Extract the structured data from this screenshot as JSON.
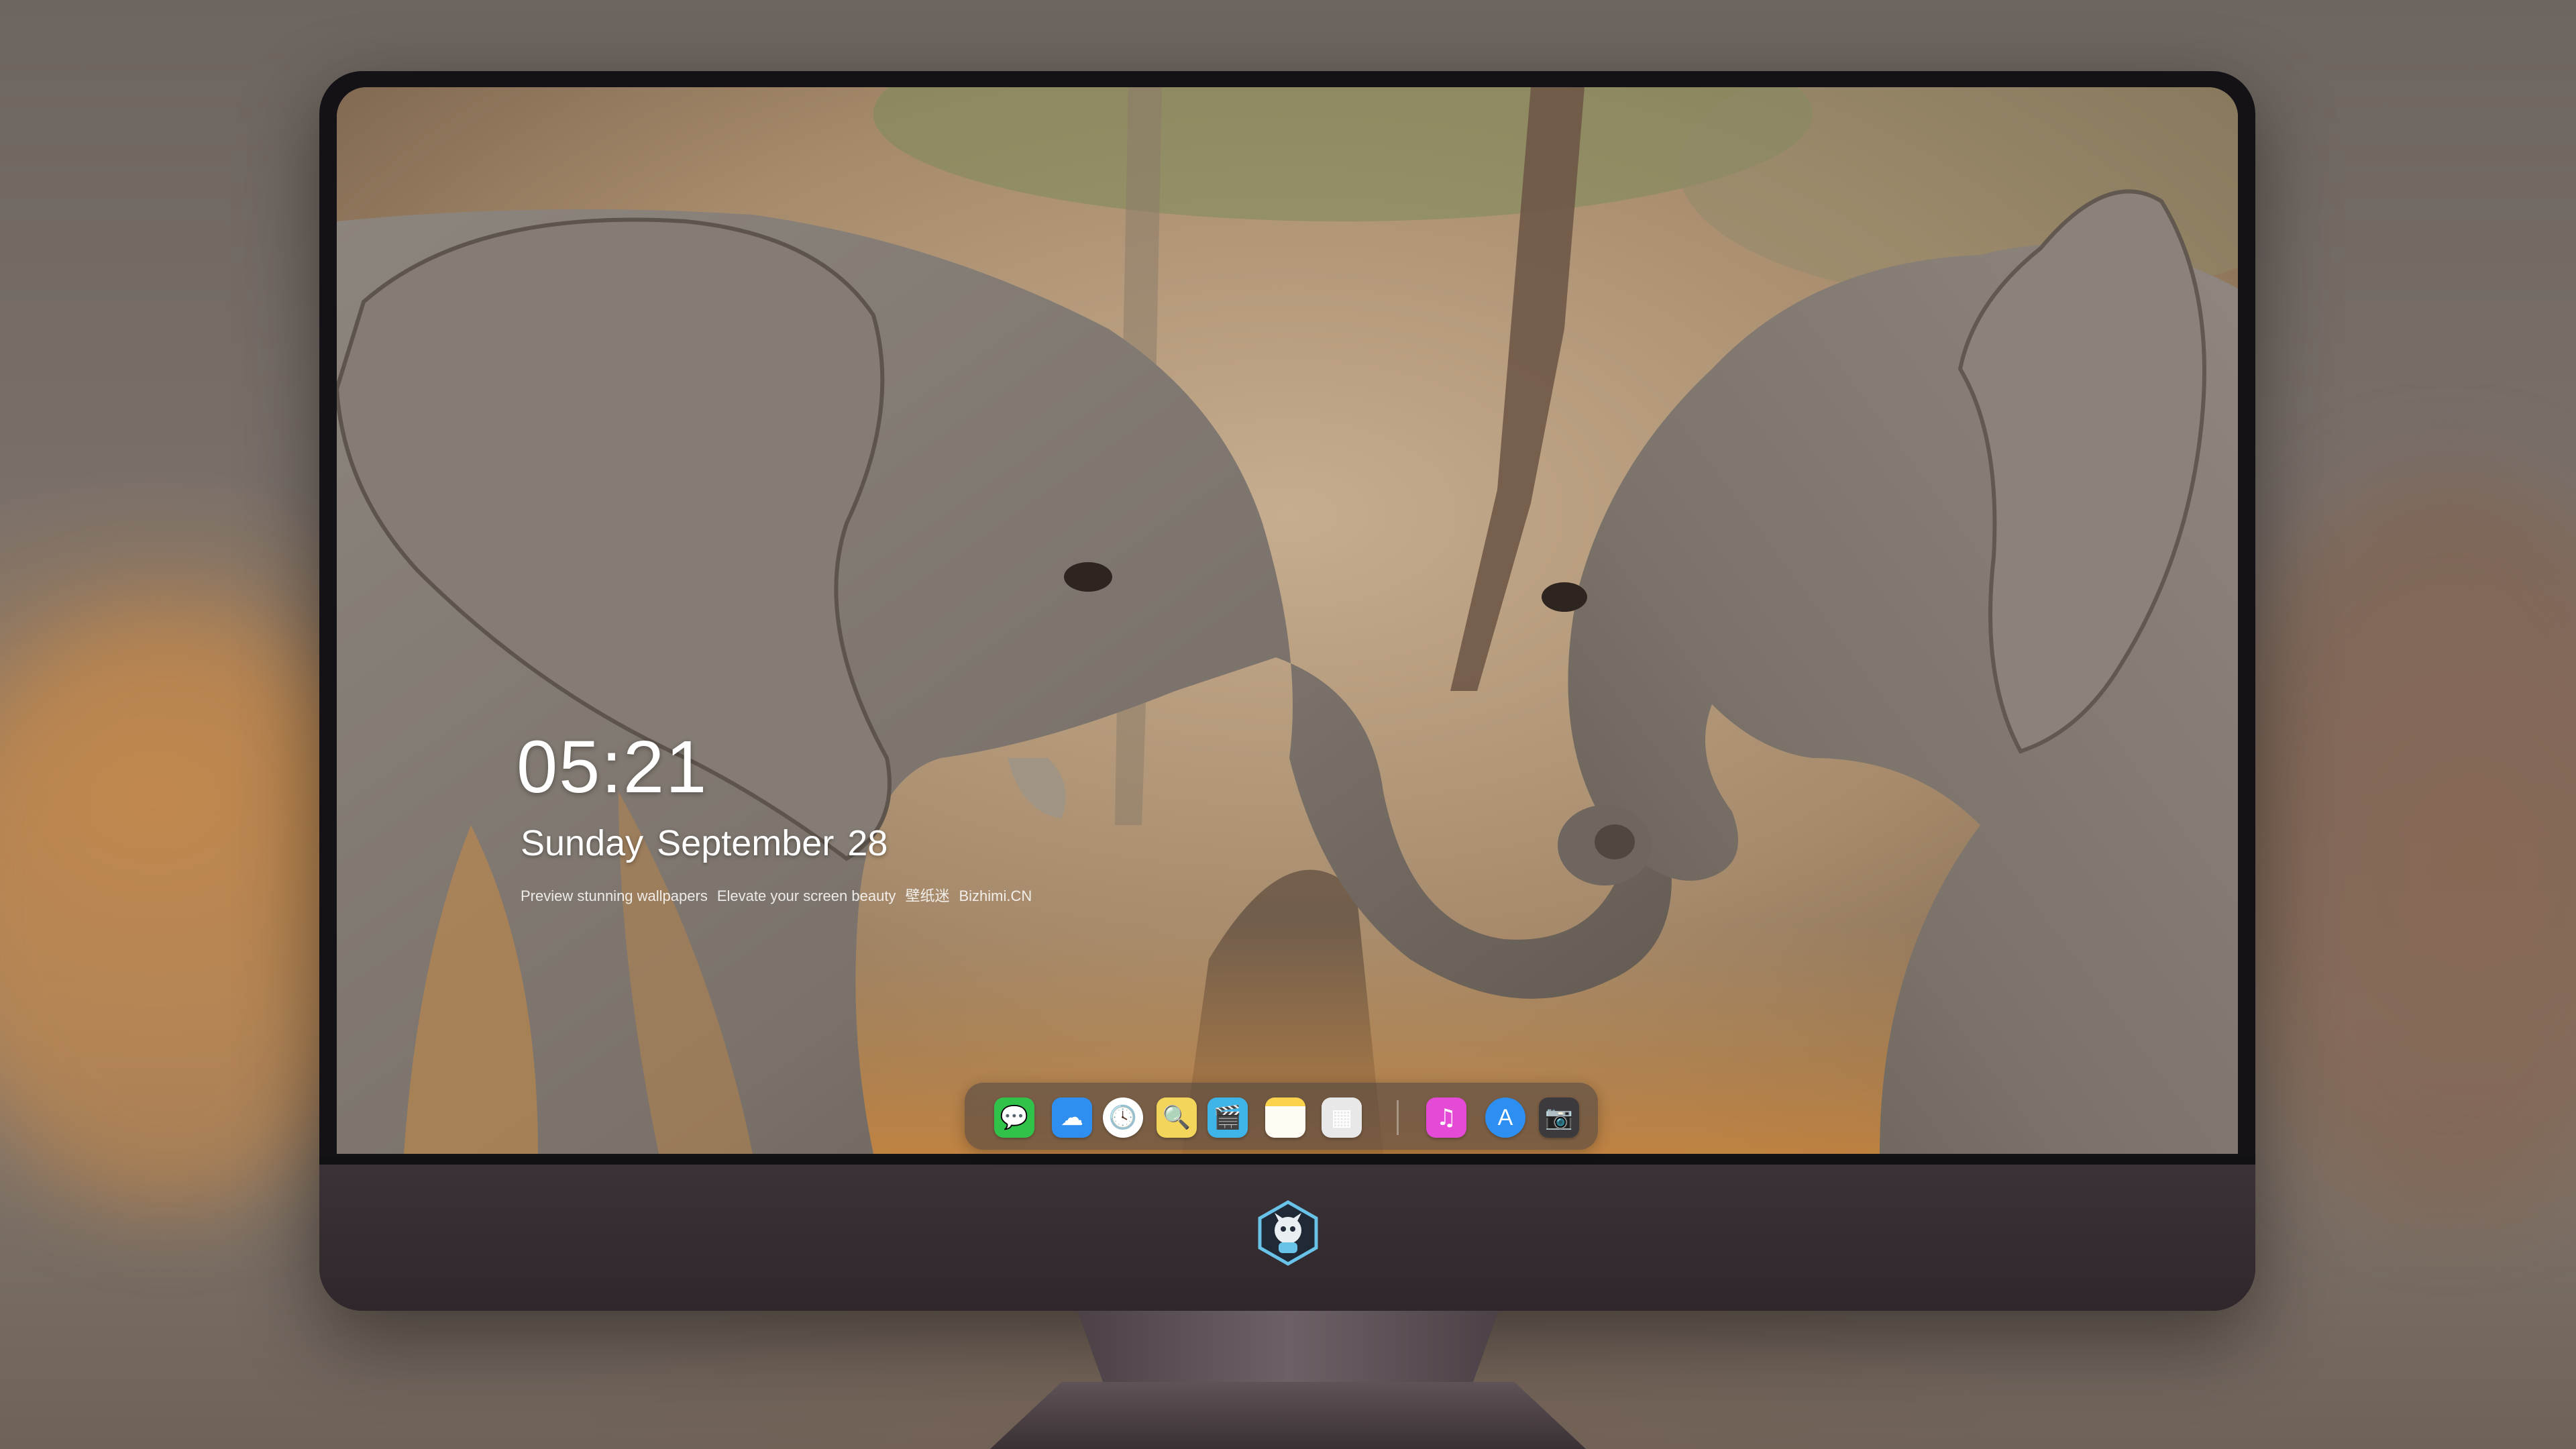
{
  "lockscreen": {
    "time": "05:21",
    "weekday": "Sunday",
    "month": "September",
    "day": "28",
    "caption": {
      "part1": "Preview stunning wallpapers",
      "part2": "Elevate your screen beauty",
      "part3": "壁纸迷",
      "part4": "Bizhimi.CN"
    }
  },
  "dock": {
    "items": [
      {
        "icon": "messages-icon",
        "glyph": "💬",
        "color": "#31c24a"
      },
      {
        "icon": "weather-icon",
        "glyph": "☁",
        "color": "#2f8ff0"
      },
      {
        "icon": "clock-icon",
        "glyph": "🕓",
        "color": "#ffffff"
      },
      {
        "icon": "preview-icon",
        "glyph": "🔍",
        "color": "#f2d55a"
      },
      {
        "icon": "clapperboard-icon",
        "glyph": "🎬",
        "color": "#3fb4e8"
      },
      {
        "icon": "notes-icon",
        "glyph": "",
        "color": "#fbe17a"
      },
      {
        "icon": "photo-booth-icon",
        "glyph": "▦",
        "color": "#e8e8e8"
      },
      {
        "icon": "music-icon",
        "glyph": "♫",
        "color": "#e54ad6"
      },
      {
        "icon": "app-store-icon",
        "glyph": "A",
        "color": "#2d8ff2"
      },
      {
        "icon": "camera-icon",
        "glyph": "📷",
        "color": "#3c3a3c"
      }
    ]
  },
  "colors": {
    "bezel": "#141216",
    "chin": "#3b3237",
    "text": "#ffffff"
  }
}
